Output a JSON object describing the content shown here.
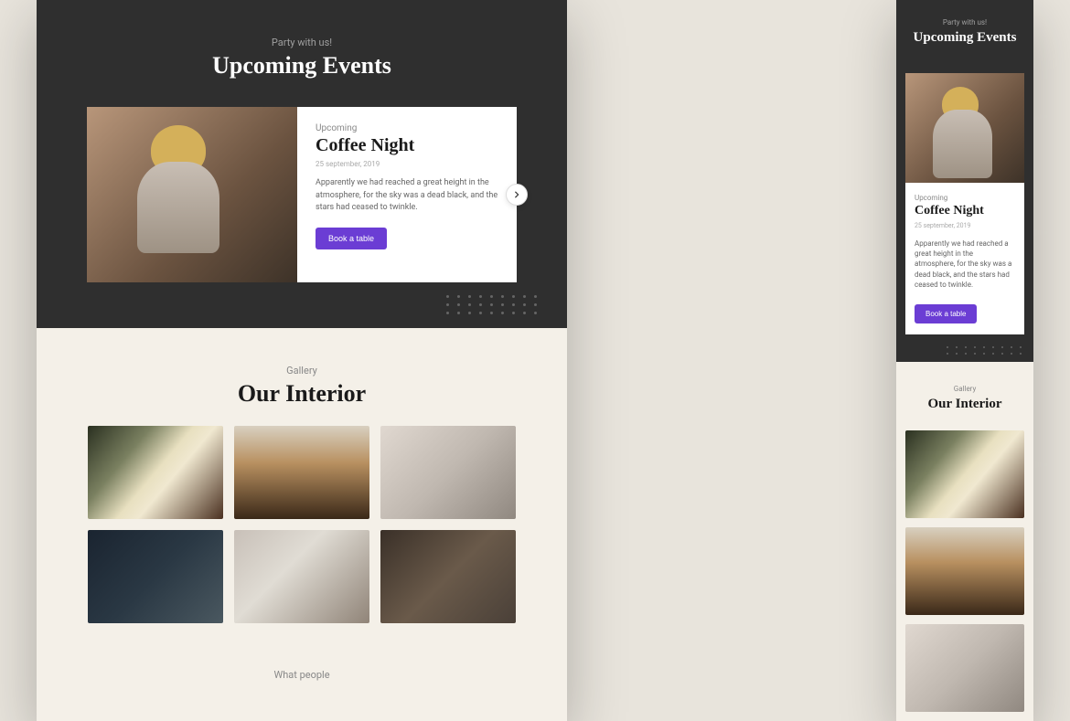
{
  "events": {
    "overline": "Party with us!",
    "title": "Upcoming Events",
    "card": {
      "tag": "Upcoming",
      "title": "Coffee Night",
      "date": "25 september, 2019",
      "text": "Apparently we had reached a great height in the atmosphere, for the sky was a dead black, and the stars had ceased to twinkle.",
      "cta": "Book a table"
    }
  },
  "gallery": {
    "overline": "Gallery",
    "title": "Our Interior"
  },
  "footer": {
    "overline": "What people"
  }
}
